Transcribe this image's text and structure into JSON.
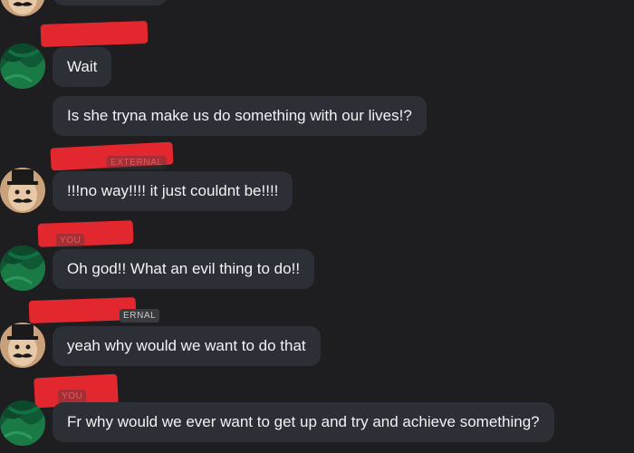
{
  "colors": {
    "background": "#1e1e20",
    "bubble": "#2c2f36",
    "text": "#f2f3f5",
    "redaction": "#e3272f"
  },
  "messages": [
    {
      "id": "m1",
      "author": "you",
      "text": "Wait"
    },
    {
      "id": "m2",
      "author": "you",
      "text": "Is she tryna make us do something with our lives!?"
    },
    {
      "id": "m3",
      "author": "external-user",
      "badge": "EXTERNAL",
      "text": "!!!no way!!!! it just couldnt be!!!!"
    },
    {
      "id": "m4",
      "author": "you",
      "badge": "YOU",
      "text": "Oh god!! What an evil thing to do!!"
    },
    {
      "id": "m5",
      "author": "external-user",
      "badge": "ERNAL",
      "text": "yeah why would we want to do that"
    },
    {
      "id": "m6",
      "author": "you",
      "badge": "YOU",
      "text": "Fr why would we ever want to get up and try and achieve something?"
    }
  ],
  "avatars": {
    "you": "green-fabric-avatar-icon",
    "external": "top-hat-mustache-avatar-icon"
  }
}
